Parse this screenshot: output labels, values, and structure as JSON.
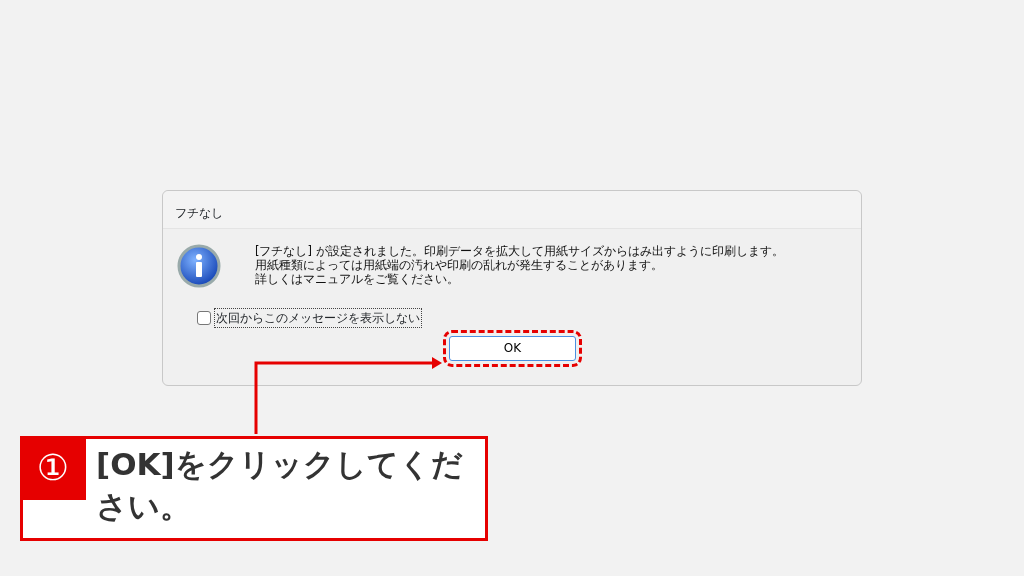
{
  "dialog": {
    "title": "フチなし",
    "message_lines": [
      "[フチなし] が設定されました。印刷データを拡大して用紙サイズからはみ出すように印刷します。",
      "用紙種類によっては用紙端の汚れや印刷の乱れが発生することがあります。",
      "詳しくはマニュアルをご覧ください。"
    ],
    "checkbox": {
      "label": "次回からこのメッセージを表示しない",
      "checked": false
    },
    "buttons": [
      "OK"
    ]
  },
  "callout": {
    "number": "①",
    "text": "[OK]をクリックしてください。"
  }
}
